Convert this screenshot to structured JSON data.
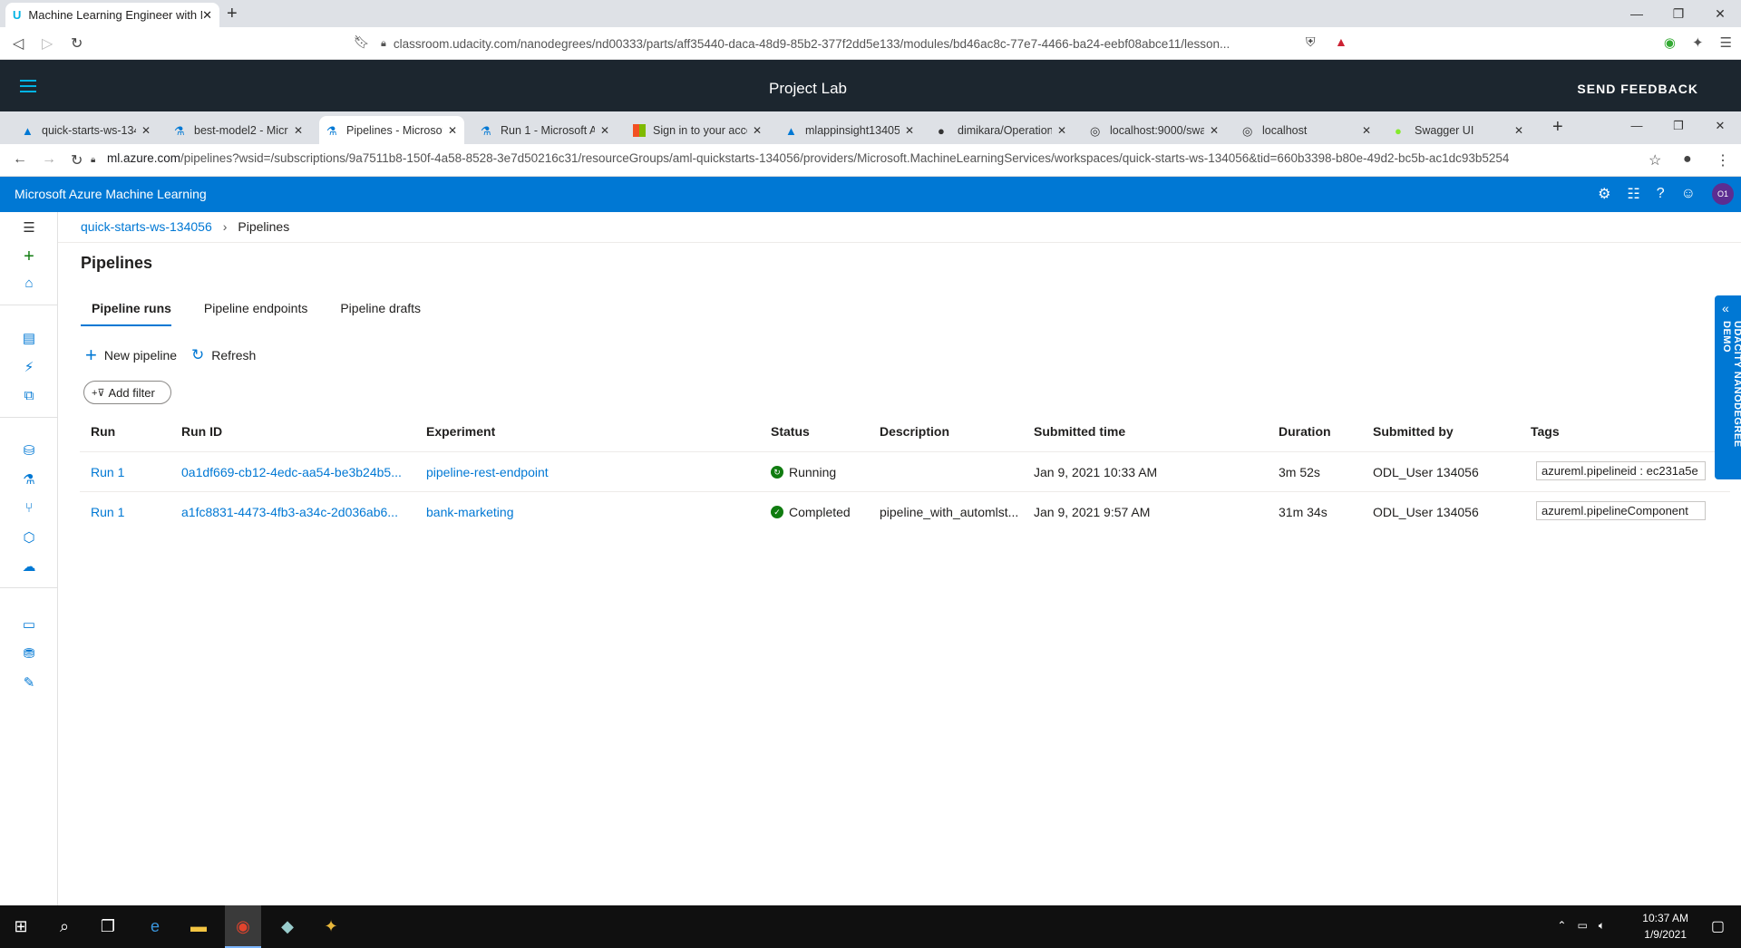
{
  "outer_browser": {
    "tab_title": "Machine Learning Engineer with M",
    "new_tab": "+",
    "url": "classroom.udacity.com/nanodegrees/nd00333/parts/aff35440-daca-48d9-85b2-377f2dd5e133/modules/bd46ac8c-77e7-4466-ba24-eebf08abce11/lesson..."
  },
  "udacity": {
    "title": "Project Lab",
    "feedback": "SEND FEEDBACK",
    "side_tab": "UDACITY NANODEGREE DEMO"
  },
  "inner_browser": {
    "tabs": [
      {
        "label": "quick-starts-ws-134",
        "icon": "azure-ml-icon"
      },
      {
        "label": "best-model2 - Micr",
        "icon": "azure-ml-icon"
      },
      {
        "label": "Pipelines - Microsof",
        "icon": "azure-ml-icon"
      },
      {
        "label": "Run 1 - Microsoft A",
        "icon": "azure-ml-icon"
      },
      {
        "label": "Sign in to your acco",
        "icon": "microsoft-icon"
      },
      {
        "label": "mlappinsight13405",
        "icon": "app-insights-icon"
      },
      {
        "label": "dimikara/Operation",
        "icon": "github-icon"
      },
      {
        "label": "localhost:9000/swag",
        "icon": "globe-icon"
      },
      {
        "label": "localhost",
        "icon": "globe-icon"
      },
      {
        "label": "Swagger UI",
        "icon": "swagger-icon"
      }
    ],
    "url_host": "ml.azure.com",
    "url_rest": "/pipelines?wsid=/subscriptions/9a7511b8-150f-4a58-8528-3e7d50216c31/resourceGroups/aml-quickstarts-134056/providers/Microsoft.MachineLearningServices/workspaces/quick-starts-ws-134056&tid=660b3398-b80e-49d2-bc5b-ac1dc93b5254"
  },
  "azure": {
    "brand": "Microsoft Azure Machine Learning",
    "avatar": "O1",
    "breadcrumb": {
      "workspace": "quick-starts-ws-134056",
      "current": "Pipelines"
    },
    "page_title": "Pipelines",
    "tabs": [
      "Pipeline runs",
      "Pipeline endpoints",
      "Pipeline drafts"
    ],
    "commands": {
      "new": "New pipeline",
      "refresh": "Refresh"
    },
    "filter": "Add filter",
    "columns": [
      "Run",
      "Run ID",
      "Experiment",
      "Status",
      "Description",
      "Submitted time",
      "Duration",
      "Submitted by",
      "Tags"
    ],
    "rows": [
      {
        "run": "Run 1",
        "run_id": "0a1df669-cb12-4edc-aa54-be3b24b5...",
        "experiment": "pipeline-rest-endpoint",
        "status": "Running",
        "status_color": "#107c10",
        "description": "",
        "submitted_time": "Jan 9, 2021 10:33 AM",
        "duration": "3m 52s",
        "submitted_by": "ODL_User 134056",
        "tags": "azureml.pipelineid : ec231a5e"
      },
      {
        "run": "Run 1",
        "run_id": "a1fc8831-4473-4fb3-a34c-2d036ab6...",
        "experiment": "bank-marketing",
        "status": "Completed",
        "status_color": "#107c10",
        "description": "pipeline_with_automlst...",
        "submitted_time": "Jan 9, 2021 9:57 AM",
        "duration": "31m 34s",
        "submitted_by": "ODL_User 134056",
        "tags": "azureml.pipelineComponent"
      }
    ]
  },
  "taskbar": {
    "time": "10:37 AM",
    "date": "1/9/2021"
  }
}
